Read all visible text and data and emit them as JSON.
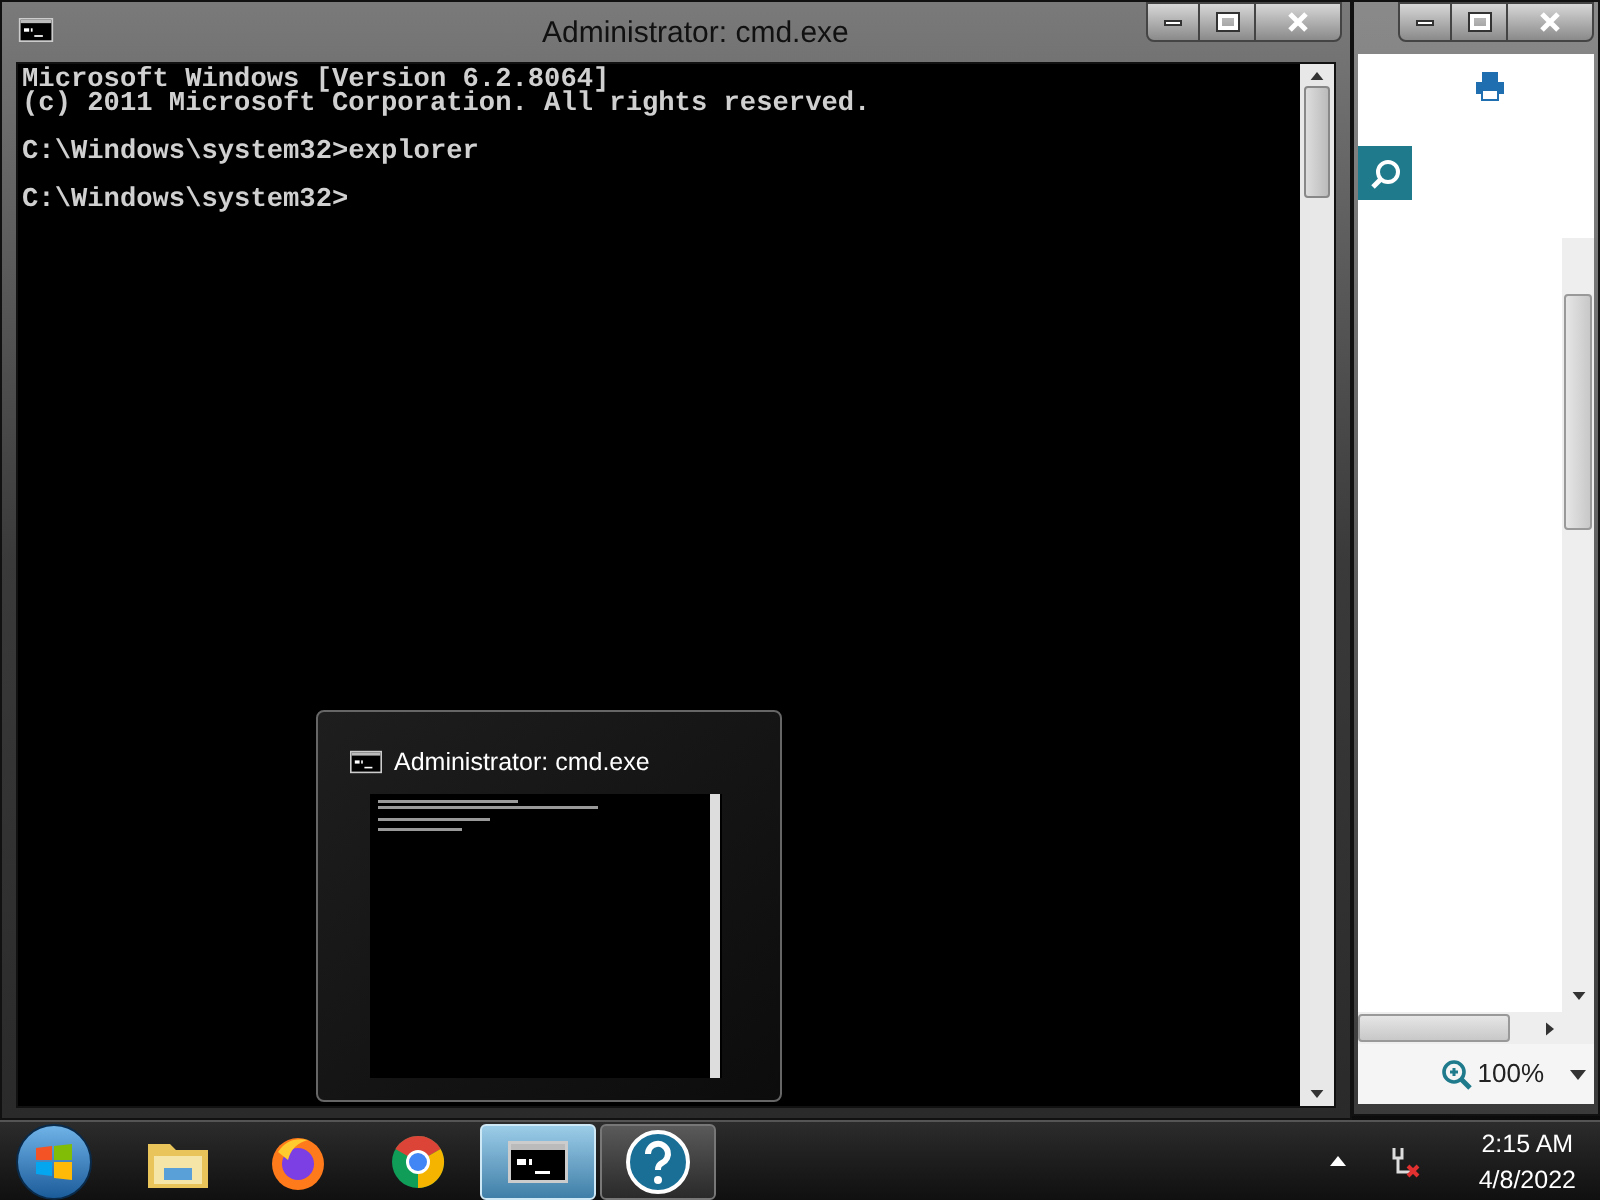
{
  "cmd_window": {
    "title": "Administrator: cmd.exe",
    "blocks": [
      [
        "Microsoft Windows [Version 6.2.8064]",
        "(c) 2011 Microsoft Corporation. All rights reserved."
      ],
      [
        "C:\\Windows\\system32>explorer"
      ],
      [
        "C:\\Windows\\system32>"
      ]
    ]
  },
  "side_window": {
    "zoom": "100%"
  },
  "thumbnail_preview": {
    "title": "Administrator: cmd.exe"
  },
  "taskbar": {
    "items": [
      {
        "kind": "folder",
        "selected": false
      },
      {
        "kind": "firefox",
        "selected": false
      },
      {
        "kind": "chrome",
        "selected": false
      },
      {
        "kind": "cmd",
        "selected": true
      },
      {
        "kind": "help",
        "selected": false
      }
    ],
    "clock": {
      "time": "2:15 AM",
      "date": "4/8/2022"
    }
  }
}
